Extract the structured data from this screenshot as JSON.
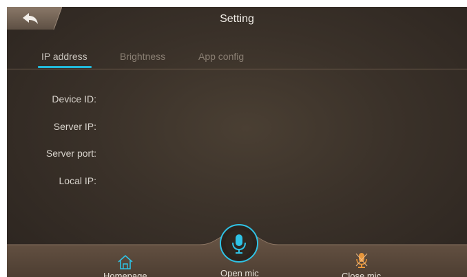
{
  "header": {
    "title": "Setting",
    "back_icon": "back-arrow-icon"
  },
  "tabs": [
    {
      "label": "IP address",
      "active": true
    },
    {
      "label": "Brightness",
      "active": false
    },
    {
      "label": "App config",
      "active": false
    }
  ],
  "fields": [
    {
      "label": "Device ID:",
      "value": ""
    },
    {
      "label": "Server IP:",
      "value": ""
    },
    {
      "label": "Server port:",
      "value": ""
    },
    {
      "label": "Local IP:",
      "value": ""
    }
  ],
  "bottom_nav": {
    "homepage": {
      "label": "Homepage",
      "icon": "home-icon"
    },
    "open_mic": {
      "label": "Open mic",
      "icon": "microphone-icon"
    },
    "close_mic": {
      "label": "Close mic",
      "icon": "microphone-off-icon"
    }
  },
  "colors": {
    "accent": "#22b8d8",
    "close_mic": "#e8963a",
    "background": "#3a3129",
    "tab_bar_bg": "#574637"
  }
}
